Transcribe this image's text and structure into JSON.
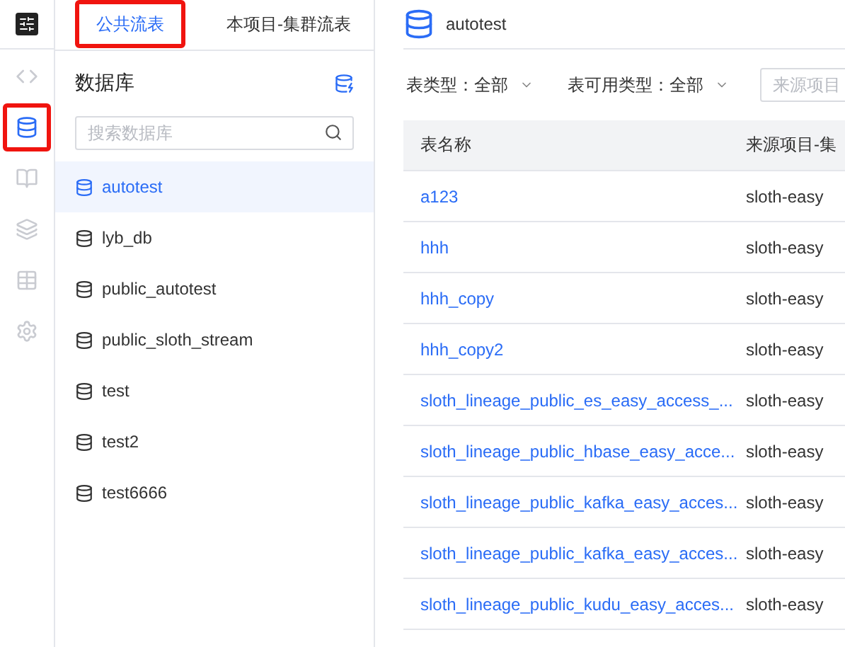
{
  "rail": {
    "items": [
      {
        "kind": "code",
        "selected": false,
        "highlighted": false
      },
      {
        "kind": "database",
        "selected": true,
        "highlighted": true
      },
      {
        "kind": "book",
        "selected": false,
        "highlighted": false
      },
      {
        "kind": "layers",
        "selected": false,
        "highlighted": false
      },
      {
        "kind": "table",
        "selected": false,
        "highlighted": false
      },
      {
        "kind": "settings",
        "selected": false,
        "highlighted": false
      }
    ]
  },
  "tabs": [
    {
      "label": "公共流表",
      "selected": true,
      "highlighted": true
    },
    {
      "label": "本项目-集群流表",
      "selected": false,
      "highlighted": false
    }
  ],
  "sidebar": {
    "title": "数据库",
    "search": {
      "placeholder": "搜索数据库"
    },
    "items": [
      {
        "label": "autotest",
        "selected": true
      },
      {
        "label": "lyb_db",
        "selected": false
      },
      {
        "label": "public_autotest",
        "selected": false
      },
      {
        "label": "public_sloth_stream",
        "selected": false
      },
      {
        "label": "test",
        "selected": false
      },
      {
        "label": "test2",
        "selected": false
      },
      {
        "label": "test6666",
        "selected": false
      }
    ]
  },
  "main": {
    "title": "autotest",
    "filters": [
      {
        "kind": "select",
        "label": "表类型：",
        "value": "全部"
      },
      {
        "kind": "select",
        "label": "表可用类型：",
        "value": "全部"
      },
      {
        "kind": "input",
        "placeholder": "来源项目"
      }
    ],
    "table": {
      "columns": [
        "表名称",
        "来源项目-集"
      ],
      "rows": [
        [
          "a123",
          "sloth-easy"
        ],
        [
          "hhh",
          "sloth-easy"
        ],
        [
          "hhh_copy",
          "sloth-easy"
        ],
        [
          "hhh_copy2",
          "sloth-easy"
        ],
        [
          "sloth_lineage_public_es_easy_access_...",
          "sloth-easy"
        ],
        [
          "sloth_lineage_public_hbase_easy_acce...",
          "sloth-easy"
        ],
        [
          "sloth_lineage_public_kafka_easy_acces...",
          "sloth-easy"
        ],
        [
          "sloth_lineage_public_kafka_easy_acces...",
          "sloth-easy"
        ],
        [
          "sloth_lineage_public_kudu_easy_acces...",
          "sloth-easy"
        ]
      ]
    }
  }
}
